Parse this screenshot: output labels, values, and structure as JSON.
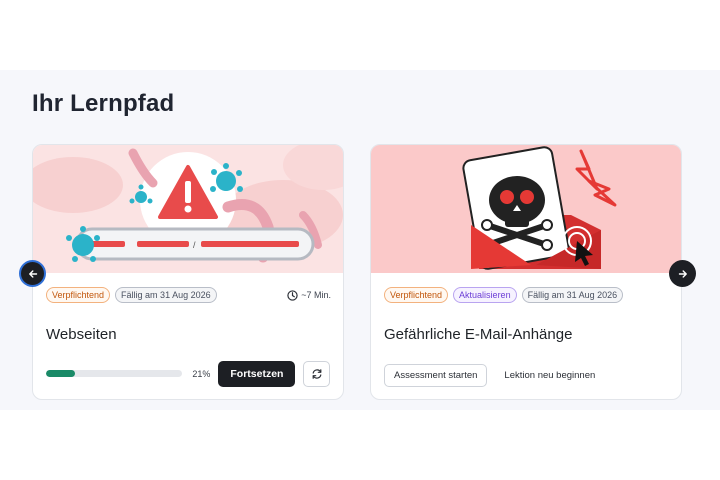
{
  "page": {
    "title": "Ihr Lernpfad"
  },
  "carousel": {
    "prev_icon": "arrow-left-icon",
    "next_icon": "arrow-right-icon"
  },
  "cards": [
    {
      "title": "Webseiten",
      "badges": [
        "Verpflichtend",
        "Fällig am 31 Aug 2026"
      ],
      "duration": "~7 Min.",
      "duration_icon": "clock-icon",
      "progress": 21,
      "progress_label": "21%",
      "primary_button": "Fortsetzen",
      "secondary_icon": "refresh-icon",
      "colors": {
        "badge_required": "#c2570c",
        "progress": "#1a8a67"
      }
    },
    {
      "title": "Gefährliche E-Mail-Anhänge",
      "badges": [
        "Verpflichtend",
        "Aktualisieren",
        "Fällig am 31 Aug 2026"
      ],
      "buttons": [
        "Assessment starten",
        "Lektion neu beginnen"
      ],
      "colors": {
        "badge_update": "#6d3fd6",
        "illustration_bg": "#fbc9c9"
      }
    }
  ]
}
